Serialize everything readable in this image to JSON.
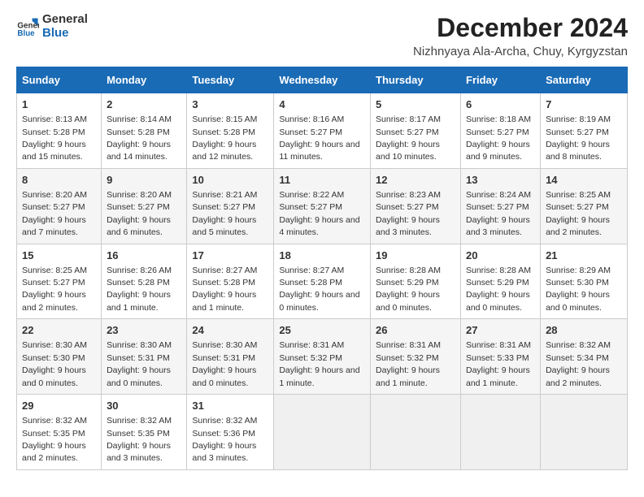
{
  "header": {
    "logo_line1": "General",
    "logo_line2": "Blue",
    "title": "December 2024",
    "subtitle": "Nizhnyaya Ala-Archa, Chuy, Kyrgyzstan"
  },
  "columns": [
    "Sunday",
    "Monday",
    "Tuesday",
    "Wednesday",
    "Thursday",
    "Friday",
    "Saturday"
  ],
  "weeks": [
    [
      {
        "day": "1",
        "sunrise": "Sunrise: 8:13 AM",
        "sunset": "Sunset: 5:28 PM",
        "daylight": "Daylight: 9 hours and 15 minutes."
      },
      {
        "day": "2",
        "sunrise": "Sunrise: 8:14 AM",
        "sunset": "Sunset: 5:28 PM",
        "daylight": "Daylight: 9 hours and 14 minutes."
      },
      {
        "day": "3",
        "sunrise": "Sunrise: 8:15 AM",
        "sunset": "Sunset: 5:28 PM",
        "daylight": "Daylight: 9 hours and 12 minutes."
      },
      {
        "day": "4",
        "sunrise": "Sunrise: 8:16 AM",
        "sunset": "Sunset: 5:27 PM",
        "daylight": "Daylight: 9 hours and 11 minutes."
      },
      {
        "day": "5",
        "sunrise": "Sunrise: 8:17 AM",
        "sunset": "Sunset: 5:27 PM",
        "daylight": "Daylight: 9 hours and 10 minutes."
      },
      {
        "day": "6",
        "sunrise": "Sunrise: 8:18 AM",
        "sunset": "Sunset: 5:27 PM",
        "daylight": "Daylight: 9 hours and 9 minutes."
      },
      {
        "day": "7",
        "sunrise": "Sunrise: 8:19 AM",
        "sunset": "Sunset: 5:27 PM",
        "daylight": "Daylight: 9 hours and 8 minutes."
      }
    ],
    [
      {
        "day": "8",
        "sunrise": "Sunrise: 8:20 AM",
        "sunset": "Sunset: 5:27 PM",
        "daylight": "Daylight: 9 hours and 7 minutes."
      },
      {
        "day": "9",
        "sunrise": "Sunrise: 8:20 AM",
        "sunset": "Sunset: 5:27 PM",
        "daylight": "Daylight: 9 hours and 6 minutes."
      },
      {
        "day": "10",
        "sunrise": "Sunrise: 8:21 AM",
        "sunset": "Sunset: 5:27 PM",
        "daylight": "Daylight: 9 hours and 5 minutes."
      },
      {
        "day": "11",
        "sunrise": "Sunrise: 8:22 AM",
        "sunset": "Sunset: 5:27 PM",
        "daylight": "Daylight: 9 hours and 4 minutes."
      },
      {
        "day": "12",
        "sunrise": "Sunrise: 8:23 AM",
        "sunset": "Sunset: 5:27 PM",
        "daylight": "Daylight: 9 hours and 3 minutes."
      },
      {
        "day": "13",
        "sunrise": "Sunrise: 8:24 AM",
        "sunset": "Sunset: 5:27 PM",
        "daylight": "Daylight: 9 hours and 3 minutes."
      },
      {
        "day": "14",
        "sunrise": "Sunrise: 8:25 AM",
        "sunset": "Sunset: 5:27 PM",
        "daylight": "Daylight: 9 hours and 2 minutes."
      }
    ],
    [
      {
        "day": "15",
        "sunrise": "Sunrise: 8:25 AM",
        "sunset": "Sunset: 5:27 PM",
        "daylight": "Daylight: 9 hours and 2 minutes."
      },
      {
        "day": "16",
        "sunrise": "Sunrise: 8:26 AM",
        "sunset": "Sunset: 5:28 PM",
        "daylight": "Daylight: 9 hours and 1 minute."
      },
      {
        "day": "17",
        "sunrise": "Sunrise: 8:27 AM",
        "sunset": "Sunset: 5:28 PM",
        "daylight": "Daylight: 9 hours and 1 minute."
      },
      {
        "day": "18",
        "sunrise": "Sunrise: 8:27 AM",
        "sunset": "Sunset: 5:28 PM",
        "daylight": "Daylight: 9 hours and 0 minutes."
      },
      {
        "day": "19",
        "sunrise": "Sunrise: 8:28 AM",
        "sunset": "Sunset: 5:29 PM",
        "daylight": "Daylight: 9 hours and 0 minutes."
      },
      {
        "day": "20",
        "sunrise": "Sunrise: 8:28 AM",
        "sunset": "Sunset: 5:29 PM",
        "daylight": "Daylight: 9 hours and 0 minutes."
      },
      {
        "day": "21",
        "sunrise": "Sunrise: 8:29 AM",
        "sunset": "Sunset: 5:30 PM",
        "daylight": "Daylight: 9 hours and 0 minutes."
      }
    ],
    [
      {
        "day": "22",
        "sunrise": "Sunrise: 8:30 AM",
        "sunset": "Sunset: 5:30 PM",
        "daylight": "Daylight: 9 hours and 0 minutes."
      },
      {
        "day": "23",
        "sunrise": "Sunrise: 8:30 AM",
        "sunset": "Sunset: 5:31 PM",
        "daylight": "Daylight: 9 hours and 0 minutes."
      },
      {
        "day": "24",
        "sunrise": "Sunrise: 8:30 AM",
        "sunset": "Sunset: 5:31 PM",
        "daylight": "Daylight: 9 hours and 0 minutes."
      },
      {
        "day": "25",
        "sunrise": "Sunrise: 8:31 AM",
        "sunset": "Sunset: 5:32 PM",
        "daylight": "Daylight: 9 hours and 1 minute."
      },
      {
        "day": "26",
        "sunrise": "Sunrise: 8:31 AM",
        "sunset": "Sunset: 5:32 PM",
        "daylight": "Daylight: 9 hours and 1 minute."
      },
      {
        "day": "27",
        "sunrise": "Sunrise: 8:31 AM",
        "sunset": "Sunset: 5:33 PM",
        "daylight": "Daylight: 9 hours and 1 minute."
      },
      {
        "day": "28",
        "sunrise": "Sunrise: 8:32 AM",
        "sunset": "Sunset: 5:34 PM",
        "daylight": "Daylight: 9 hours and 2 minutes."
      }
    ],
    [
      {
        "day": "29",
        "sunrise": "Sunrise: 8:32 AM",
        "sunset": "Sunset: 5:35 PM",
        "daylight": "Daylight: 9 hours and 2 minutes."
      },
      {
        "day": "30",
        "sunrise": "Sunrise: 8:32 AM",
        "sunset": "Sunset: 5:35 PM",
        "daylight": "Daylight: 9 hours and 3 minutes."
      },
      {
        "day": "31",
        "sunrise": "Sunrise: 8:32 AM",
        "sunset": "Sunset: 5:36 PM",
        "daylight": "Daylight: 9 hours and 3 minutes."
      },
      null,
      null,
      null,
      null
    ]
  ]
}
